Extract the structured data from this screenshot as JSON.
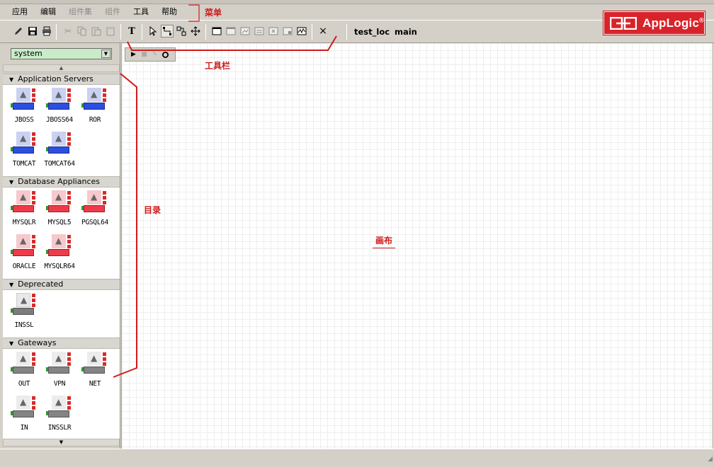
{
  "menu": [
    "应用",
    "编辑",
    "组件集",
    "组件",
    "工具",
    "帮助"
  ],
  "menu_disabled": [
    false,
    false,
    true,
    true,
    false,
    false
  ],
  "toolbar": {
    "icons": [
      "pencil-icon",
      "save-icon",
      "print-icon",
      "cut-icon",
      "copy-icon",
      "paste-icon",
      "clipboard-icon",
      "text-icon",
      "pointer-icon",
      "connect-icon",
      "group-icon",
      "move-icon",
      "window1-icon",
      "window2-icon",
      "window3-icon",
      "window4-icon",
      "window5-icon",
      "window6-icon",
      "chart-icon",
      "close-icon"
    ],
    "text_label": "T",
    "close_label": "×",
    "app_name": "test_loc",
    "assembly_name": "main"
  },
  "logo": {
    "text": "AppLogic",
    "mark": "®"
  },
  "catalog": {
    "selected": "system",
    "sections": [
      {
        "title": "Application Servers",
        "items": [
          {
            "label": "JBOSS",
            "color": "blue"
          },
          {
            "label": "JBOSS64",
            "color": "blue"
          },
          {
            "label": "ROR",
            "color": "blue"
          },
          {
            "label": "TOMCAT",
            "color": "blue"
          },
          {
            "label": "TOMCAT64",
            "color": "blue"
          }
        ]
      },
      {
        "title": "Database Appliances",
        "items": [
          {
            "label": "MYSQLR",
            "color": "red"
          },
          {
            "label": "MYSQL5",
            "color": "red"
          },
          {
            "label": "PGSQL64",
            "color": "red"
          },
          {
            "label": "ORACLE",
            "color": "red"
          },
          {
            "label": "MYSQLR64",
            "color": "red"
          }
        ]
      },
      {
        "title": "Deprecated",
        "items": [
          {
            "label": "INSSL",
            "color": "gray"
          }
        ]
      },
      {
        "title": "Gateways",
        "items": [
          {
            "label": "OUT",
            "color": "gray2"
          },
          {
            "label": "VPN",
            "color": "gray2"
          },
          {
            "label": "NET",
            "color": "gray2"
          },
          {
            "label": "IN",
            "color": "gray2"
          },
          {
            "label": "INSSLR",
            "color": "gray2"
          }
        ]
      }
    ]
  },
  "annotations": {
    "menu": "菜单",
    "toolbar": "工具栏",
    "catalog": "目录",
    "canvas": "画布",
    "color": "#d01a1a"
  },
  "canvas_tools": [
    "play-icon",
    "stop-icon",
    "edit-icon",
    "refresh-icon"
  ]
}
